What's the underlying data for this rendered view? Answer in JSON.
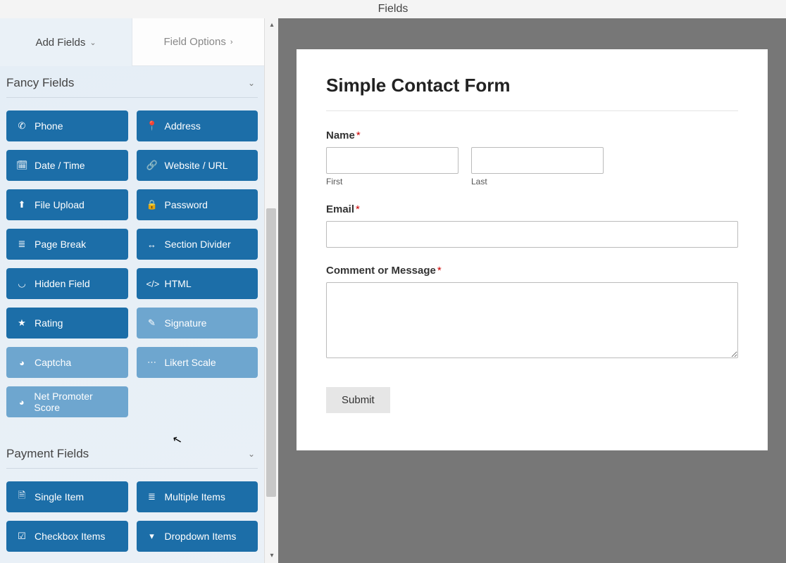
{
  "header": {
    "title": "Fields"
  },
  "tabs": {
    "add": "Add Fields",
    "options": "Field Options"
  },
  "sections": {
    "fancy": {
      "title": "Fancy Fields",
      "items": [
        {
          "label": "Phone",
          "icon": "phone",
          "light": false
        },
        {
          "label": "Address",
          "icon": "pin",
          "light": false
        },
        {
          "label": "Date / Time",
          "icon": "calendar",
          "light": false
        },
        {
          "label": "Website / URL",
          "icon": "link",
          "light": false
        },
        {
          "label": "File Upload",
          "icon": "upload",
          "light": false
        },
        {
          "label": "Password",
          "icon": "lock",
          "light": false
        },
        {
          "label": "Page Break",
          "icon": "pagebreak",
          "light": false
        },
        {
          "label": "Section Divider",
          "icon": "divider",
          "light": false
        },
        {
          "label": "Hidden Field",
          "icon": "eye-off",
          "light": false
        },
        {
          "label": "HTML",
          "icon": "code",
          "light": false
        },
        {
          "label": "Rating",
          "icon": "star",
          "light": false
        },
        {
          "label": "Signature",
          "icon": "pencil",
          "light": true
        },
        {
          "label": "Captcha",
          "icon": "gauge",
          "light": true
        },
        {
          "label": "Likert Scale",
          "icon": "dots",
          "light": true
        },
        {
          "label": "Net Promoter Score",
          "icon": "gauge",
          "light": true
        }
      ]
    },
    "payment": {
      "title": "Payment Fields",
      "items": [
        {
          "label": "Single Item",
          "icon": "file",
          "light": false
        },
        {
          "label": "Multiple Items",
          "icon": "list",
          "light": false
        },
        {
          "label": "Checkbox Items",
          "icon": "check",
          "light": false
        },
        {
          "label": "Dropdown Items",
          "icon": "dropdown",
          "light": false
        }
      ]
    }
  },
  "form": {
    "title": "Simple Contact Form",
    "name_label": "Name",
    "first_sub": "First",
    "last_sub": "Last",
    "email_label": "Email",
    "comment_label": "Comment or Message",
    "submit": "Submit"
  }
}
